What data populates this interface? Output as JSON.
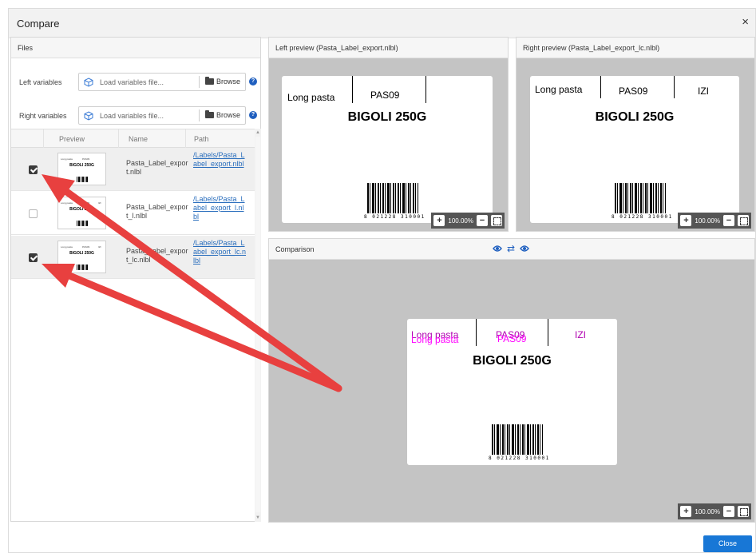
{
  "dialog": {
    "title": "Compare",
    "close_icon": "×"
  },
  "files": {
    "title": "Files",
    "left_vars": {
      "label": "Left variables",
      "placeholder": "Load variables file...",
      "browse": "Browse",
      "help": "?"
    },
    "right_vars": {
      "label": "Right variables",
      "placeholder": "Load variables file...",
      "browse": "Browse",
      "help": "?"
    },
    "columns": [
      "Preview",
      "Name",
      "Path"
    ],
    "rows": [
      {
        "checked": true,
        "name": "Pasta_Label_export.nlbl",
        "path": "/Labels/Pasta_Label_export.nlbl"
      },
      {
        "checked": false,
        "name": "Pasta_Label_export_l.nlbl",
        "path": "/Labels/Pasta_Label_export_l.nlbl"
      },
      {
        "checked": true,
        "name": "Pasta_Label_export_lc.nlbl",
        "path": "/Labels/Pasta_Label_export_lc.nlbl"
      }
    ]
  },
  "left_preview": {
    "title": "Left preview (Pasta_Label_export.nlbl)",
    "label": {
      "field1": "Long pasta",
      "field2": "PAS09",
      "title": "BIGOLI 250G",
      "barcode": "8 021228 310001"
    },
    "zoom": "100.00%"
  },
  "right_preview": {
    "title": "Right preview (Pasta_Label_export_lc.nlbl)",
    "label": {
      "field1": "Long pasta",
      "field2": "PAS09",
      "field3": "IZI",
      "title": "BIGOLI 250G",
      "barcode": "8 021228 310001"
    },
    "zoom": "100.00%"
  },
  "comparison": {
    "title": "Comparison",
    "label": {
      "field1": "Long pasta",
      "field2": "PAS09",
      "field3": "IZI",
      "title": "BIGOLI 250G",
      "barcode": "8 021228 310001"
    },
    "zoom": "100.00%",
    "diff_color": "#ff00ff"
  },
  "footer": {
    "close": "Close"
  },
  "annotation_color": "#e8403f"
}
